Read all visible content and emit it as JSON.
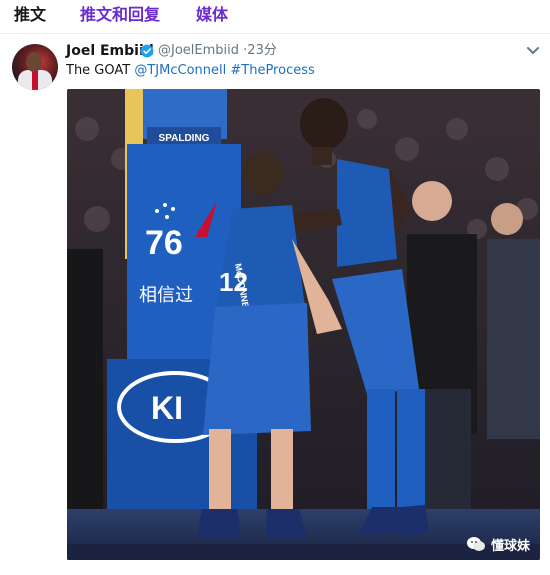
{
  "tabs": {
    "items": [
      {
        "label": "推文"
      },
      {
        "label": "推文和回复"
      },
      {
        "label": "媒体"
      }
    ]
  },
  "tweet": {
    "author_name": "Joel Embiid",
    "author_handle": "@JoelEmbiid",
    "separator": "·",
    "time": "23分",
    "text_plain": "The GOAT ",
    "mention": "@TJMcConnell",
    "space": " ",
    "hashtag": "#TheProcess"
  },
  "media": {
    "jersey_left_name": "McCONNELL",
    "jersey_left_number": "12",
    "banner_logo_text": "76",
    "banner_cn_text": "相信过",
    "scoreboard_brand": "SPALDING",
    "sponsor_text": "KI",
    "watermark_text": "懂球妹"
  },
  "colors": {
    "link": "#1b6fc5",
    "tab_accent": "#6a2bd0",
    "verified": "#1da1f2",
    "sixers_blue": "#1d5bb5",
    "sixers_red": "#c8102e"
  },
  "icons": [
    "verified-badge-icon",
    "chevron-down-icon",
    "wechat-icon"
  ]
}
